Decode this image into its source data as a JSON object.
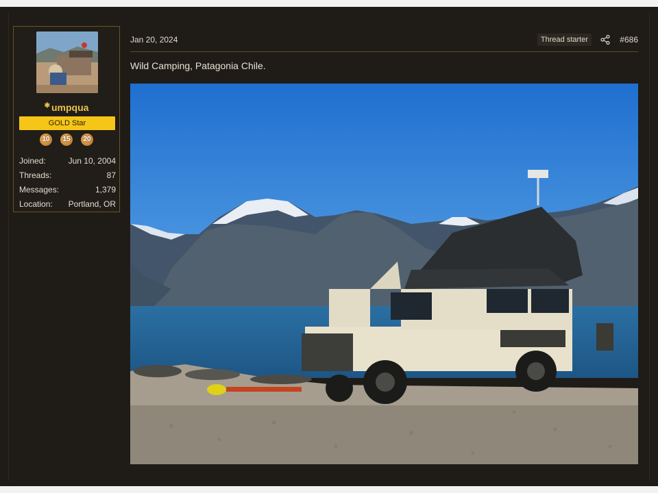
{
  "user": {
    "username": "umpqua",
    "role": "GOLD Star",
    "trophies": [
      "10",
      "15",
      "20"
    ],
    "stats": [
      {
        "label": "Joined:",
        "value": "Jun 10, 2004"
      },
      {
        "label": "Threads:",
        "value": "87"
      },
      {
        "label": "Messages:",
        "value": "1,379"
      },
      {
        "label": "Location:",
        "value": "Portland, OR"
      }
    ]
  },
  "post": {
    "date": "Jan 20, 2024",
    "starter_badge": "Thread starter",
    "number": "#686",
    "text": "Wild Camping, Patagonia Chile."
  },
  "icons": {
    "share": "share-icon",
    "username_star": "star-icon"
  },
  "colors": {
    "background": "#1f1c18",
    "username": "#e9c34a",
    "role_badge": "#f5c518",
    "card_border": "#6a5524"
  }
}
